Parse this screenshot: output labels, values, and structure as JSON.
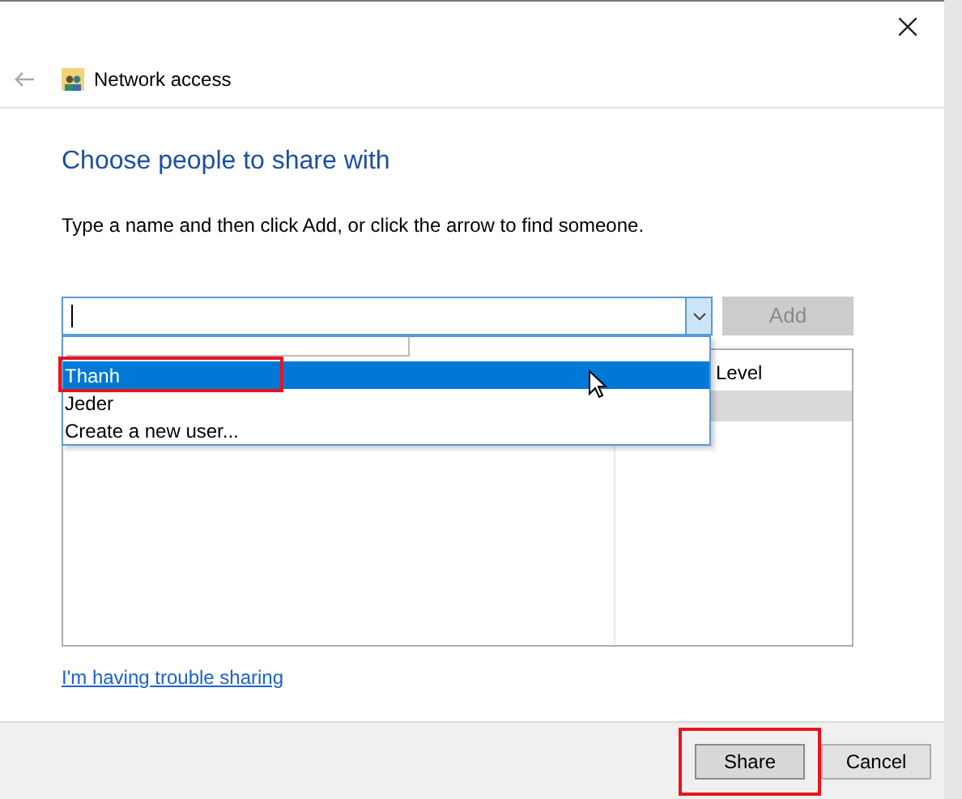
{
  "window": {
    "title": "Network access"
  },
  "heading": "Choose people to share with",
  "instruction": "Type a name and then click Add, or click the arrow to find someone.",
  "add_button": {
    "label": "Add",
    "disabled": true
  },
  "table": {
    "column_2": "Level"
  },
  "dropdown": {
    "items": [
      {
        "label": "Thanh",
        "selected": true,
        "highlighted": true
      },
      {
        "label": "Jeder",
        "selected": false,
        "highlighted": false
      },
      {
        "label": "Create a new user...",
        "selected": false,
        "highlighted": false
      }
    ]
  },
  "trouble_link": "I'm having trouble sharing",
  "buttons": [
    {
      "label": "Share",
      "highlighted": true
    },
    {
      "label": "Cancel",
      "highlighted": false
    }
  ]
}
